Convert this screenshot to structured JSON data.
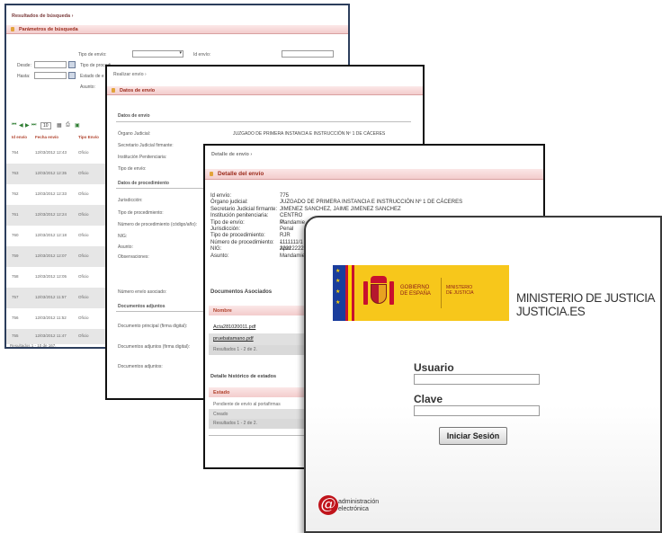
{
  "search_window": {
    "breadcrumb": "Resultados de búsqueda ›",
    "section_title": "Parámetros de búsqueda",
    "labels": {
      "tipo_envio": "Tipo de envío:",
      "id_envio": "Id envío:",
      "desde": "Desde:",
      "hasta": "Hasta:",
      "tipo_procedimiento": "Tipo de procedi",
      "estado": "Estado de e",
      "asunto": "Asunto:"
    },
    "pagination_text": "10",
    "table_headers": [
      "Id envío",
      "Fecha envío",
      "Tipo Envío"
    ],
    "rows": [
      [
        "764",
        "12/03/2012 12:43",
        "Oficio"
      ],
      [
        "763",
        "12/03/2012 12:35",
        "Oficio"
      ],
      [
        "762",
        "12/03/2012 12:33",
        "Oficio"
      ],
      [
        "761",
        "12/03/2012 12:24",
        "Oficio"
      ],
      [
        "760",
        "12/03/2012 12:18",
        "Oficio"
      ],
      [
        "759",
        "12/03/2012 12:07",
        "Oficio"
      ],
      [
        "758",
        "12/03/2012 12:05",
        "Oficio"
      ],
      [
        "757",
        "12/03/2012 11:57",
        "Oficio"
      ],
      [
        "756",
        "12/03/2012 11:52",
        "Oficio"
      ],
      [
        "755",
        "12/03/2012 11:47",
        "Oficio"
      ]
    ],
    "results_text": "Resultados 1 - 10 de 167."
  },
  "send_window": {
    "breadcrumb": "Realizar envío ›",
    "section_title": "Datos de envío",
    "sub_envio": "Datos de envío",
    "organo_label": "Órgano Judicial:",
    "organo_value": "JUZGADO DE PRIMERA INSTANCIA E INSTRUCCIÓN Nº 1 DE CÁCERES",
    "secretario_label": "Secretario Judicial firmante:",
    "institucion_label": "Institución Penitenciaria:",
    "tipo_envio_label": "Tipo de envío:",
    "sub_procedimiento": "Datos de procedimiento",
    "jurisdiccion_label": "Jurisdicción:",
    "tipo_proc_label": "Tipo de procedimiento:",
    "num_proc_label": "Número de procedimiento (código/año):",
    "nig_label": "NIG:",
    "asunto_label": "Asunto:",
    "observaciones_label": "Observaciones:",
    "numero_asociado_label": "Número envío asociado:",
    "sub_documentos": "Documentos adjuntos",
    "doc_principal_label": "Documento principal (firma digital):",
    "docs_adjuntos_firma_label": "Documentos adjuntos (firma digital):",
    "docs_adjuntos_label": "Documentos adjuntos:"
  },
  "detail_window": {
    "breadcrumb": "Detalle de envío ›",
    "section_title": "Detalle del envío",
    "fields": [
      {
        "label": "Id envío:",
        "value": "775"
      },
      {
        "label": "Órgano judicial:",
        "value": "JUZGADO DE PRIMERA INSTANCIA E INSTRUCCIÓN Nº 1 DE CÁCERES"
      },
      {
        "label": "Secretario Judicial firmante:",
        "value": "JIMENEZ SANCHEZ, JAIME JIMENEZ SANCHEZ"
      },
      {
        "label": "Institución penitenciaria:",
        "value": "CENTRO P"
      },
      {
        "label": "Tipo de envío:",
        "value": "Mandamie"
      },
      {
        "label": "Jurisdicción:",
        "value": "Penal"
      },
      {
        "label": "Tipo de procedimiento:",
        "value": "RJR - Apel"
      },
      {
        "label": "Número de procedimiento:",
        "value": "1111111/1"
      },
      {
        "label": "NIG:",
        "value": "22222222"
      },
      {
        "label": "Asunto:",
        "value": "Mandamie"
      }
    ],
    "docs_title": "Documentos Asociados",
    "docs_header": "Nombre",
    "docs": [
      "Acta281020011.pdf",
      "pruebatamano.pdf"
    ],
    "docs_results": "Resultados 1 - 2 de 2.",
    "history_title": "Detalle histórico de estados",
    "history_header": "Estado",
    "history": [
      "Pendiente de envío al portafirmas",
      "Creado"
    ],
    "history_results": "Resultados 1 - 2 de 2."
  },
  "login_window": {
    "gov_line1": "GOBIERNO",
    "gov_line2": "DE ESPAÑA",
    "min_line1": "MINISTERIO",
    "min_line2": "DE JUSTICIA",
    "title_line1": "MINISTERIO DE JUSTICIA",
    "title_line2": "JUSTICIA.ES",
    "usuario_label": "Usuario",
    "clave_label": "Clave",
    "submit_label": "Iniciar Sesión",
    "footer_line1": "administración",
    "footer_line2": "electrónica",
    "colors": {
      "banner_yellow": "#f7c71b",
      "flag_red": "#c8102e",
      "flag_yellow": "#ffd200",
      "eu_blue": "#1a3d9c"
    }
  }
}
